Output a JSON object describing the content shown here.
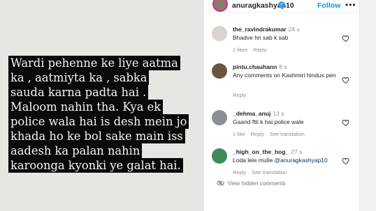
{
  "post": {
    "caption_lines": [
      "Wardi pehenne ke liye aatma",
      "ka , aatmiyta ka , sabka",
      "sauda karna padta hai .",
      "Maloom nahin tha. Kya ek",
      "police wala hai is desh mein jo",
      "khada ho ke bol sake main iss",
      "aadesh ka palan nahin",
      "karoonga kyonki ye galat hai."
    ]
  },
  "header": {
    "username": "anuragkashyap10",
    "follow_label": "Follow",
    "more_label": "•••"
  },
  "comments": [
    {
      "user": "the_ravindrakumar",
      "time": "24 s",
      "text": "Bhadve hn sab k sab",
      "likes": "2 likes",
      "reply": "Reply",
      "translation": ""
    },
    {
      "user": "pintu.chauhann",
      "time": "8 s",
      "text": "Any comments on Kashmiri hindus pen",
      "likes": "",
      "reply": "Reply",
      "translation": ""
    },
    {
      "user": "_dehma_anuj",
      "time": "13 s",
      "text": "Gaand ftti k hai police wale",
      "likes": "1 like",
      "reply": "Reply",
      "translation": "See translation"
    },
    {
      "user": "_high_on_the_hog_",
      "time": "27 s",
      "text_prefix": "Loda lele mulle ",
      "mention": "@anuragkashyap10",
      "likes": "",
      "reply": "Reply",
      "translation": "See translation"
    }
  ],
  "view_hidden_label": "View hidden comments",
  "colors": {
    "accent": "#0095f6",
    "caption_bg": "#0a0a0a",
    "muted": "#8e8e8e"
  }
}
